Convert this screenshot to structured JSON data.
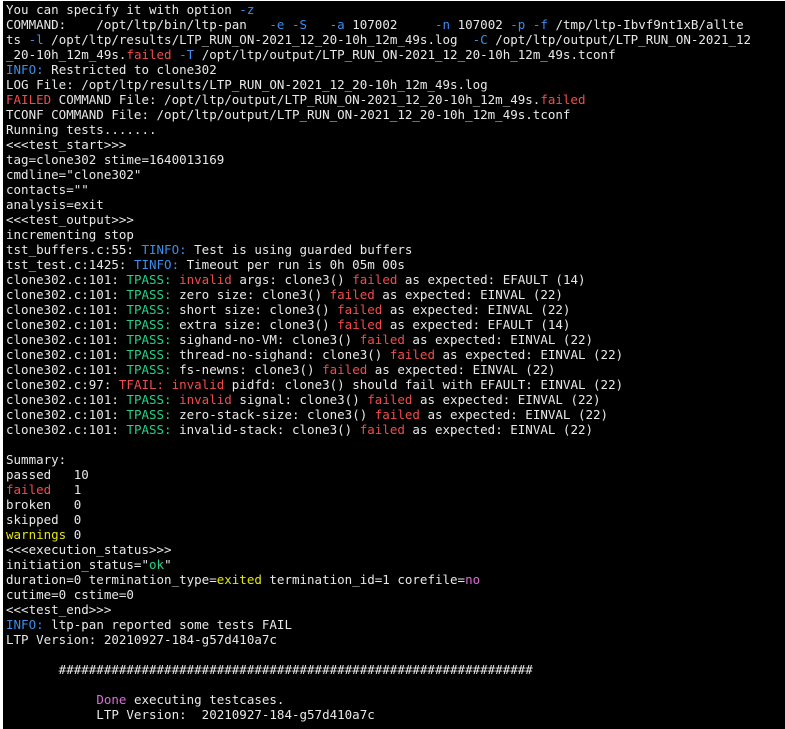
{
  "colors": {
    "background": "#000000",
    "white": "#e8e8e8",
    "blue": "#3b8eea",
    "red": "#f14c4c",
    "green": "#23d18b",
    "yellow": "#e5e510",
    "magenta": "#d670d6",
    "cyan": "#29b8db"
  },
  "lines": [
    [
      {
        "t": "You can specify it with option ",
        "c": "white"
      },
      {
        "t": "-z",
        "c": "blue"
      }
    ],
    [
      {
        "t": "COMMAND:    /opt/ltp/bin/ltp-pan   ",
        "c": "white"
      },
      {
        "t": "-e -S",
        "c": "blue"
      },
      {
        "t": "   ",
        "c": "white"
      },
      {
        "t": "-a",
        "c": "blue"
      },
      {
        "t": " 107002     ",
        "c": "white"
      },
      {
        "t": "-n",
        "c": "blue"
      },
      {
        "t": " 107002 ",
        "c": "white"
      },
      {
        "t": "-p -f",
        "c": "blue"
      },
      {
        "t": " /tmp/ltp-Ibvf9nt1xB/allte",
        "c": "white"
      }
    ],
    [
      {
        "t": "ts ",
        "c": "white"
      },
      {
        "t": "-l",
        "c": "blue"
      },
      {
        "t": " /opt/ltp/results/LTP_RUN_ON-2021_12_20-10h_12m_49s.log  ",
        "c": "white"
      },
      {
        "t": "-C",
        "c": "blue"
      },
      {
        "t": " /opt/ltp/output/LTP_RUN_ON-2021_12",
        "c": "white"
      }
    ],
    [
      {
        "t": "_20-10h_12m_49s.",
        "c": "white"
      },
      {
        "t": "failed",
        "c": "red"
      },
      {
        "t": " ",
        "c": "white"
      },
      {
        "t": "-T",
        "c": "blue"
      },
      {
        "t": " /opt/ltp/output/LTP_RUN_ON-2021_12_20-10h_12m_49s.tconf",
        "c": "white"
      }
    ],
    [
      {
        "t": "INFO:",
        "c": "blue"
      },
      {
        "t": " Restricted to clone302",
        "c": "white"
      }
    ],
    [
      {
        "t": "LOG File: /opt/ltp/results/LTP_RUN_ON-2021_12_20-10h_12m_49s.log",
        "c": "white"
      }
    ],
    [
      {
        "t": "FAILED",
        "c": "red"
      },
      {
        "t": " COMMAND File: /opt/ltp/output/LTP_RUN_ON-2021_12_20-10h_12m_49s.",
        "c": "white"
      },
      {
        "t": "failed",
        "c": "red"
      }
    ],
    [
      {
        "t": "TCONF COMMAND File: /opt/ltp/output/LTP_RUN_ON-2021_12_20-10h_12m_49s.tconf",
        "c": "white"
      }
    ],
    [
      {
        "t": "Running tests.......",
        "c": "white"
      }
    ],
    [
      {
        "t": "<<<test_start>>>",
        "c": "white"
      }
    ],
    [
      {
        "t": "tag=clone302 stime=1640013169",
        "c": "white"
      }
    ],
    [
      {
        "t": "cmdline=\"clone302\"",
        "c": "white"
      }
    ],
    [
      {
        "t": "contacts=\"\"",
        "c": "white"
      }
    ],
    [
      {
        "t": "analysis=exit",
        "c": "white"
      }
    ],
    [
      {
        "t": "<<<test_output>>>",
        "c": "white"
      }
    ],
    [
      {
        "t": "incrementing stop",
        "c": "white"
      }
    ],
    [
      {
        "t": "tst_buffers.c:55: ",
        "c": "white"
      },
      {
        "t": "TINFO:",
        "c": "blue"
      },
      {
        "t": " Test is using guarded buffers",
        "c": "white"
      }
    ],
    [
      {
        "t": "tst_test.c:1425: ",
        "c": "white"
      },
      {
        "t": "TINFO:",
        "c": "blue"
      },
      {
        "t": " Timeout per run is 0h 05m 00s",
        "c": "white"
      }
    ],
    [
      {
        "t": "clone302.c:101: ",
        "c": "white"
      },
      {
        "t": "TPASS:",
        "c": "green"
      },
      {
        "t": " ",
        "c": "white"
      },
      {
        "t": "invalid",
        "c": "red"
      },
      {
        "t": " args: clone3() ",
        "c": "white"
      },
      {
        "t": "failed",
        "c": "red"
      },
      {
        "t": " as expected: EFAULT (14)",
        "c": "white"
      }
    ],
    [
      {
        "t": "clone302.c:101: ",
        "c": "white"
      },
      {
        "t": "TPASS:",
        "c": "green"
      },
      {
        "t": " zero size: clone3() ",
        "c": "white"
      },
      {
        "t": "failed",
        "c": "red"
      },
      {
        "t": " as expected: EINVAL (22)",
        "c": "white"
      }
    ],
    [
      {
        "t": "clone302.c:101: ",
        "c": "white"
      },
      {
        "t": "TPASS:",
        "c": "green"
      },
      {
        "t": " short size: clone3() ",
        "c": "white"
      },
      {
        "t": "failed",
        "c": "red"
      },
      {
        "t": " as expected: EINVAL (22)",
        "c": "white"
      }
    ],
    [
      {
        "t": "clone302.c:101: ",
        "c": "white"
      },
      {
        "t": "TPASS:",
        "c": "green"
      },
      {
        "t": " extra size: clone3() ",
        "c": "white"
      },
      {
        "t": "failed",
        "c": "red"
      },
      {
        "t": " as expected: EFAULT (14)",
        "c": "white"
      }
    ],
    [
      {
        "t": "clone302.c:101: ",
        "c": "white"
      },
      {
        "t": "TPASS:",
        "c": "green"
      },
      {
        "t": " sighand-no-VM: clone3() ",
        "c": "white"
      },
      {
        "t": "failed",
        "c": "red"
      },
      {
        "t": " as expected: EINVAL (22)",
        "c": "white"
      }
    ],
    [
      {
        "t": "clone302.c:101: ",
        "c": "white"
      },
      {
        "t": "TPASS:",
        "c": "green"
      },
      {
        "t": " thread-no-sighand: clone3() ",
        "c": "white"
      },
      {
        "t": "failed",
        "c": "red"
      },
      {
        "t": " as expected: EINVAL (22)",
        "c": "white"
      }
    ],
    [
      {
        "t": "clone302.c:101: ",
        "c": "white"
      },
      {
        "t": "TPASS:",
        "c": "green"
      },
      {
        "t": " fs-newns: clone3() ",
        "c": "white"
      },
      {
        "t": "failed",
        "c": "red"
      },
      {
        "t": " as expected: EINVAL (22)",
        "c": "white"
      }
    ],
    [
      {
        "t": "clone302.c:97: ",
        "c": "white"
      },
      {
        "t": "TFAIL:",
        "c": "red"
      },
      {
        "t": " ",
        "c": "white"
      },
      {
        "t": "invalid",
        "c": "red"
      },
      {
        "t": " pidfd: clone3() should fail with EFAULT: EINVAL (22)",
        "c": "white"
      }
    ],
    [
      {
        "t": "clone302.c:101: ",
        "c": "white"
      },
      {
        "t": "TPASS:",
        "c": "green"
      },
      {
        "t": " ",
        "c": "white"
      },
      {
        "t": "invalid",
        "c": "red"
      },
      {
        "t": " signal: clone3() ",
        "c": "white"
      },
      {
        "t": "failed",
        "c": "red"
      },
      {
        "t": " as expected: EINVAL (22)",
        "c": "white"
      }
    ],
    [
      {
        "t": "clone302.c:101: ",
        "c": "white"
      },
      {
        "t": "TPASS:",
        "c": "green"
      },
      {
        "t": " zero-stack-size: clone3() ",
        "c": "white"
      },
      {
        "t": "failed",
        "c": "red"
      },
      {
        "t": " as expected: EINVAL (22)",
        "c": "white"
      }
    ],
    [
      {
        "t": "clone302.c:101: ",
        "c": "white"
      },
      {
        "t": "TPASS:",
        "c": "green"
      },
      {
        "t": " invalid-stack: clone3() ",
        "c": "white"
      },
      {
        "t": "failed",
        "c": "red"
      },
      {
        "t": " as expected: EINVAL (22)",
        "c": "white"
      }
    ],
    [
      {
        "t": "",
        "c": "white"
      }
    ],
    [
      {
        "t": "Summary:",
        "c": "white"
      }
    ],
    [
      {
        "t": "passed   10",
        "c": "white"
      }
    ],
    [
      {
        "t": "failed",
        "c": "red"
      },
      {
        "t": "   1",
        "c": "white"
      }
    ],
    [
      {
        "t": "broken   0",
        "c": "white"
      }
    ],
    [
      {
        "t": "skipped  0",
        "c": "white"
      }
    ],
    [
      {
        "t": "warnings",
        "c": "yellow"
      },
      {
        "t": " 0",
        "c": "white"
      }
    ],
    [
      {
        "t": "<<<execution_status>>>",
        "c": "white"
      }
    ],
    [
      {
        "t": "initiation_status=\"",
        "c": "white"
      },
      {
        "t": "ok",
        "c": "green"
      },
      {
        "t": "\"",
        "c": "white"
      }
    ],
    [
      {
        "t": "duration=0 termination_type=",
        "c": "white"
      },
      {
        "t": "exited",
        "c": "yellow"
      },
      {
        "t": " termination_id=1 corefile=",
        "c": "white"
      },
      {
        "t": "no",
        "c": "magenta"
      }
    ],
    [
      {
        "t": "cutime=0 cstime=0",
        "c": "white"
      }
    ],
    [
      {
        "t": "<<<test_end>>>",
        "c": "white"
      }
    ],
    [
      {
        "t": "INFO:",
        "c": "blue"
      },
      {
        "t": " ltp-pan reported some tests FAIL",
        "c": "white"
      }
    ],
    [
      {
        "t": "LTP Version: 20210927-184-g57d410a7c",
        "c": "white"
      }
    ],
    [
      {
        "t": "",
        "c": "white"
      }
    ],
    [
      {
        "t": "       ###############################################################",
        "c": "white"
      }
    ],
    [
      {
        "t": "",
        "c": "white"
      }
    ],
    [
      {
        "t": "            ",
        "c": "white"
      },
      {
        "t": "Done",
        "c": "magenta"
      },
      {
        "t": " executing testcases.",
        "c": "white"
      }
    ],
    [
      {
        "t": "            LTP Version:  20210927-184-g57d410a7c",
        "c": "white"
      }
    ]
  ]
}
